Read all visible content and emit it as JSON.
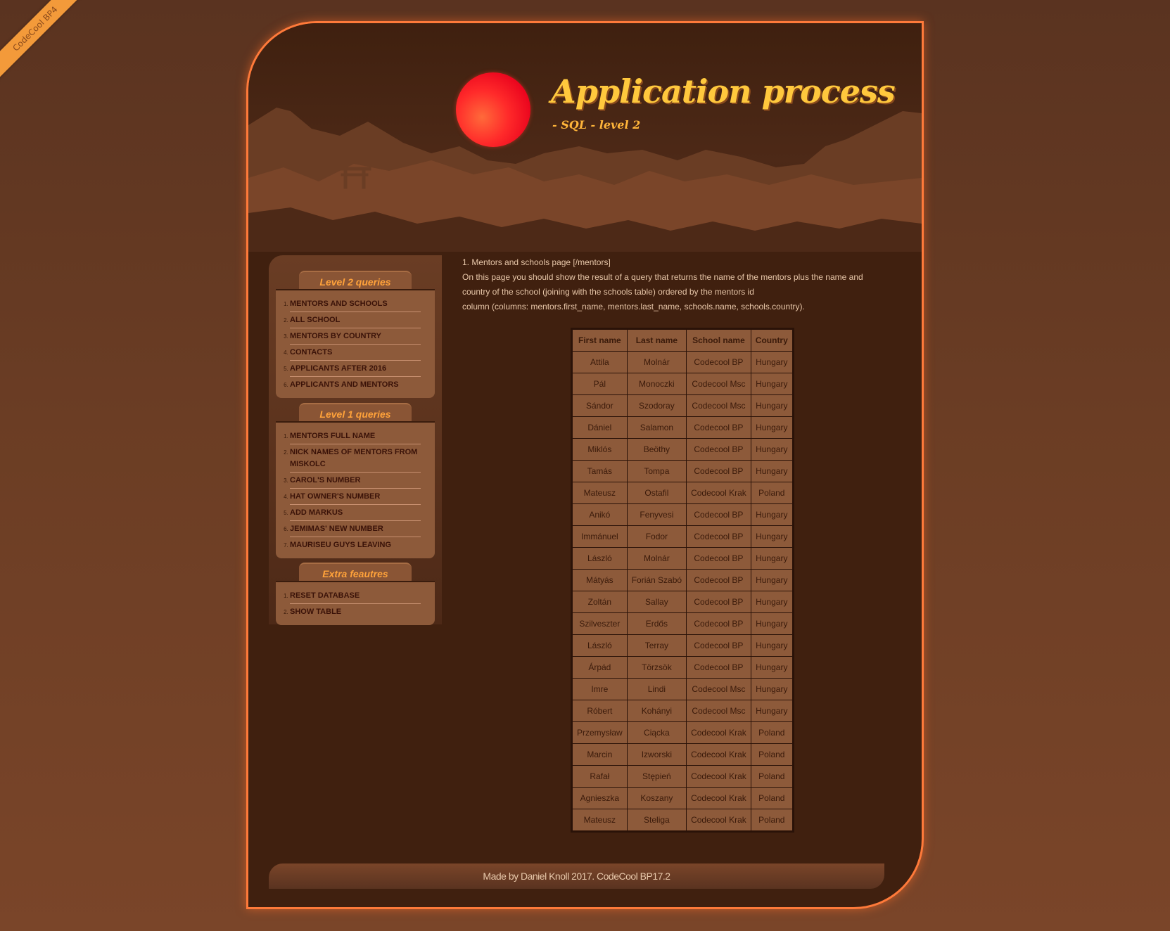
{
  "ribbon": "CodeCool BP4",
  "header": {
    "title": "Application process",
    "subtitle": "- SQL - level 2"
  },
  "sidebar": {
    "sections": [
      {
        "title": "Level 2 queries",
        "items": [
          "MENTORS AND SCHOOLS",
          "ALL SCHOOL",
          "MENTORS BY COUNTRY",
          "CONTACTS",
          "APPLICANTS AFTER 2016",
          "APPLICANTS AND MENTORS"
        ]
      },
      {
        "title": "Level 1 queries",
        "items": [
          "MENTORS FULL NAME",
          "NICK NAMES OF MENTORS FROM MISKOLC",
          "CAROL'S NUMBER",
          "HAT OWNER'S NUMBER",
          "ADD MARKUS",
          "JEMIMAS' NEW NUMBER",
          "MAURISEU GUYS LEAVING"
        ]
      },
      {
        "title": "Extra feautres",
        "items": [
          "RESET DATABASE",
          "SHOW TABLE"
        ]
      }
    ]
  },
  "main": {
    "heading": "1. Mentors and schools page [/mentors]",
    "description_line1": "On this page you should show the result of a query that returns the name of the mentors plus the name and",
    "description_line2": "country of the school (joining with the schools table) ordered by the mentors id",
    "description_line3": "column (columns: mentors.first_name, mentors.last_name, schools.name, schools.country).",
    "table": {
      "headers": [
        "First name",
        "Last name",
        "School name",
        "Country"
      ],
      "rows": [
        [
          "Attila",
          "Molnár",
          "Codecool BP",
          "Hungary"
        ],
        [
          "Pál",
          "Monoczki",
          "Codecool Msc",
          "Hungary"
        ],
        [
          "Sándor",
          "Szodoray",
          "Codecool Msc",
          "Hungary"
        ],
        [
          "Dániel",
          "Salamon",
          "Codecool BP",
          "Hungary"
        ],
        [
          "Miklós",
          "Beöthy",
          "Codecool BP",
          "Hungary"
        ],
        [
          "Tamás",
          "Tompa",
          "Codecool BP",
          "Hungary"
        ],
        [
          "Mateusz",
          "Ostafil",
          "Codecool Krak",
          "Poland"
        ],
        [
          "Anikó",
          "Fenyvesi",
          "Codecool BP",
          "Hungary"
        ],
        [
          "Immánuel",
          "Fodor",
          "Codecool BP",
          "Hungary"
        ],
        [
          "László",
          "Molnár",
          "Codecool BP",
          "Hungary"
        ],
        [
          "Mátyás",
          "Forián Szabó",
          "Codecool BP",
          "Hungary"
        ],
        [
          "Zoltán",
          "Sallay",
          "Codecool BP",
          "Hungary"
        ],
        [
          "Szilveszter",
          "Erdős",
          "Codecool BP",
          "Hungary"
        ],
        [
          "László",
          "Terray",
          "Codecool BP",
          "Hungary"
        ],
        [
          "Árpád",
          "Törzsök",
          "Codecool BP",
          "Hungary"
        ],
        [
          "Imre",
          "Lindi",
          "Codecool Msc",
          "Hungary"
        ],
        [
          "Róbert",
          "Kohányi",
          "Codecool Msc",
          "Hungary"
        ],
        [
          "Przemysław",
          "Ciącka",
          "Codecool Krak",
          "Poland"
        ],
        [
          "Marcin",
          "Izworski",
          "Codecool Krak",
          "Poland"
        ],
        [
          "Rafał",
          "Stępień",
          "Codecool Krak",
          "Poland"
        ],
        [
          "Agnieszka",
          "Koszany",
          "Codecool Krak",
          "Poland"
        ],
        [
          "Mateusz",
          "Steliga",
          "Codecool Krak",
          "Poland"
        ]
      ]
    }
  },
  "footer": "Made by Daniel Knoll 2017. CodeCool BP17.2",
  "colors": {
    "accent": "#ff7a3a",
    "title": "#ffc83d",
    "background": "#40200f"
  }
}
